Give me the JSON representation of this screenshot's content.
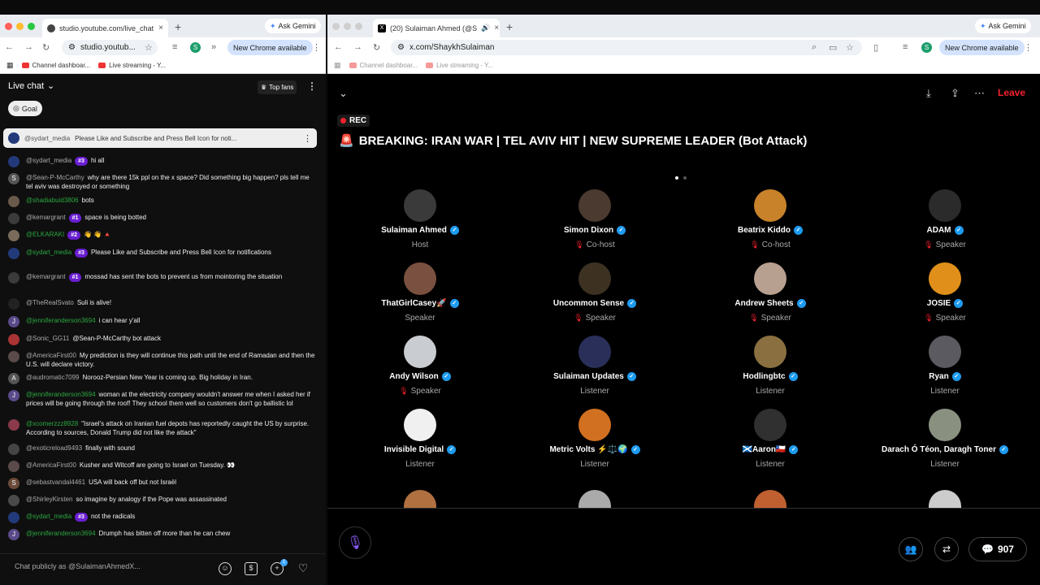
{
  "left_browser": {
    "tab_title": "studio.youtube.com/live_chat",
    "ask": "Ask Gemini",
    "url": "studio.youtub...",
    "profile": "S",
    "new_chrome": "New Chrome available",
    "bookmarks": [
      "Channel dashboar...",
      "Live streaming - Y..."
    ]
  },
  "right_browser": {
    "tab_title": "(20) Sulaiman Ahmed (@S",
    "ask": "Ask Gemini",
    "url": "x.com/ShaykhSulaiman",
    "profile": "S",
    "new_chrome": "New Chrome available",
    "bookmarks": [
      "Channel dashboar...",
      "Live streaming - Y..."
    ]
  },
  "chat": {
    "title": "Live chat",
    "top_fans": "Top fans",
    "goal": "Goal",
    "pinned_user": "@sydart_media",
    "pinned_text": "Please Like and Subscribe and Press Bell Icon for noti...",
    "placeholder": "Chat publicly as @SulaimanAhmedX...",
    "badge_count": "1",
    "messages": [
      {
        "user": "@sydart_media",
        "badge": "#3",
        "text": "hi all",
        "green": false,
        "init": ""
      },
      {
        "user": "@Sean-P-McCarthy",
        "badge": "",
        "text": "why are there 15k ppl on the x space? Did something big happen? pls tell me tel aviv was destroyed or something",
        "green": false,
        "init": "S"
      },
      {
        "user": "@shadiabuid3806",
        "badge": "",
        "text": "bots",
        "green": true,
        "init": ""
      },
      {
        "user": "@kemargrant",
        "badge": "#1",
        "text": "space is being botted",
        "green": false,
        "init": ""
      },
      {
        "user": "@ELKARAKI",
        "badge": "#2",
        "text": "👋 👋 🔺",
        "green": true,
        "init": ""
      },
      {
        "user": "@sydart_media",
        "badge": "#3",
        "text": "Please Like and Subscribe and Press Bell Icon for notifications",
        "green": true,
        "init": ""
      },
      {
        "user": "@kemargrant",
        "badge": "#1",
        "text": "mossad has sent the bots to prevent us from mointoring the situation",
        "green": false,
        "init": ""
      },
      {
        "user": "@TheRealSvato",
        "badge": "",
        "text": "Suli is alive!",
        "green": false,
        "init": ""
      },
      {
        "user": "@jenniferanderson3694",
        "badge": "",
        "text": "i can hear y'all",
        "green": true,
        "init": "J"
      },
      {
        "user": "@Sonic_GG11",
        "badge": "",
        "text": "@Sean-P-McCarthy bot attack",
        "green": false,
        "init": ""
      },
      {
        "user": "@AmericaFirst00",
        "badge": "",
        "text": "My prediction is they will continue this path until the end of Ramadan and then the U.S. will declare victory.",
        "green": false,
        "init": ""
      },
      {
        "user": "@audromatic7099",
        "badge": "",
        "text": "Norooz-Persian New Year is coming up. Big holiday in Iran.",
        "green": false,
        "init": "A"
      },
      {
        "user": "@jenniferanderson3694",
        "badge": "",
        "text": "woman at the electricity company wouldn't answer me when I asked her if prices will be going through the roof! They school them well so customers don't go ballistic lol",
        "green": true,
        "init": "J"
      },
      {
        "user": "@xcomerzzz8928",
        "badge": "",
        "text": "\"Israel's attack on Iranian fuel depots has reportedly caught the US by surprise. According to sources, Donald Trump did not like the attack\"",
        "green": true,
        "init": ""
      },
      {
        "user": "@exoticreload9493",
        "badge": "",
        "text": "finally with sound",
        "green": false,
        "init": ""
      },
      {
        "user": "@AmericaFirst00",
        "badge": "",
        "text": "Kusher and Witcoff are going to Israel on Tuesday. 👀",
        "green": false,
        "init": ""
      },
      {
        "user": "@sebastvandal4461",
        "badge": "",
        "text": "USA will back off but not Israël",
        "green": false,
        "init": "S"
      },
      {
        "user": "@ShirleyKirsten",
        "badge": "",
        "text": "so imagine by analogy if the Pope was assassinated",
        "green": false,
        "init": ""
      },
      {
        "user": "@sydart_media",
        "badge": "#3",
        "text": "not the radicals",
        "green": true,
        "init": ""
      },
      {
        "user": "@jenniferanderson3694",
        "badge": "",
        "text": "Drumph has bitten off more than he can chew",
        "green": true,
        "init": "J"
      }
    ]
  },
  "space": {
    "rec": "REC",
    "title": "BREAKING: IRAN WAR | TEL AVIV HIT | NEW SUPREME LEADER (Bot Attack)",
    "leave": "Leave",
    "comments": "907",
    "people": [
      {
        "name": "Sulaiman Ahmed",
        "role": "Host",
        "color": "#3a3a3a",
        "mic": false
      },
      {
        "name": "Simon Dixon",
        "role": "Co-host",
        "color": "#4a3a30",
        "mic": true
      },
      {
        "name": "Beatrix Kiddo",
        "role": "Co-host",
        "color": "#c8822a",
        "mic": true
      },
      {
        "name": "ADAM",
        "role": "Speaker",
        "color": "#2b2b2b",
        "mic": true
      },
      {
        "name": "ThatGirlCasey🚀",
        "role": "Speaker",
        "color": "#7a5040",
        "mic": false
      },
      {
        "name": "Uncommon Sense",
        "role": "Speaker",
        "color": "#3d3222",
        "mic": true
      },
      {
        "name": "Andrew Sheets",
        "role": "Speaker",
        "color": "#b8a090",
        "mic": true
      },
      {
        "name": "JOSIE",
        "role": "Speaker",
        "color": "#e0901a",
        "mic": true
      },
      {
        "name": "Andy Wilson",
        "role": "Speaker",
        "color": "#c9ccd0",
        "mic": true
      },
      {
        "name": "Sulaiman Updates",
        "role": "Listener",
        "color": "#2a2f5a",
        "mic": false
      },
      {
        "name": "Hodlingbtc",
        "role": "Listener",
        "color": "#8a7040",
        "mic": false
      },
      {
        "name": "Ryan",
        "role": "Listener",
        "color": "#5a5a60",
        "mic": false
      },
      {
        "name": "Invisible Digital",
        "role": "Listener",
        "color": "#f0f0f0",
        "mic": false
      },
      {
        "name": "Metric Volts ⚡⚖️🌍",
        "role": "Listener",
        "color": "#d07020",
        "mic": false
      },
      {
        "name": "🏴󠁧󠁢󠁳󠁣󠁴󠁿Aaron🇨🇱",
        "role": "Listener",
        "color": "#303030",
        "mic": false
      },
      {
        "name": "Darach Ó Téon, Daragh Toner",
        "role": "Listener",
        "color": "#8a9080",
        "mic": false
      }
    ]
  },
  "icons": [
    "search-icon",
    "star-icon",
    "mic-icon",
    "people-icon",
    "share-icon",
    "comment-icon",
    "heart-icon",
    "emoji-icon",
    "chevron-down-icon"
  ]
}
